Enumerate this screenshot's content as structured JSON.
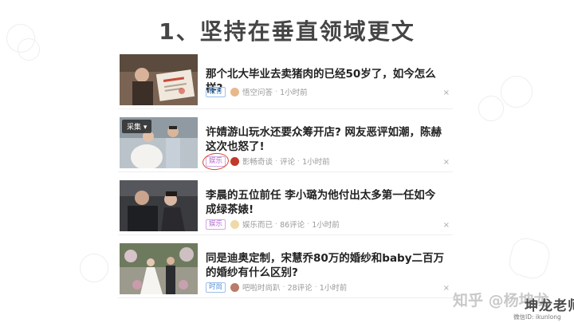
{
  "title": "1、坚持在垂直领域更文",
  "articles": [
    {
      "headline": "那个北大毕业去卖猪肉的已经50岁了，如今怎么样?",
      "tag": "教育",
      "author": "悟空问答",
      "time": "1小时前",
      "close": "×"
    },
    {
      "headline": "许婧游山玩水还要众筹开店? 网友恶评如潮，陈赫这次也怒了!",
      "thumb_overlay": "采集 ▾",
      "tag": "娱乐",
      "author": "影畅奇谈",
      "comments": "评论",
      "time": "1小时前",
      "close": "×"
    },
    {
      "headline": "李晨的五位前任 李小璐为他付出太多第一任如今成绿茶婊!",
      "tag": "娱乐",
      "author": "娱乐而已",
      "comments": "86评论",
      "time": "1小时前",
      "close": "×"
    },
    {
      "headline": "同是迪奥定制，宋慧乔80万的婚纱和baby二百万的婚纱有什么区别?",
      "tag": "时尚",
      "author": "吧啦时尚趴",
      "comments": "28评论",
      "time": "1小时前",
      "close": "×"
    }
  ],
  "watermark": "知乎 @杨坤龙",
  "brand": "坤龙老师",
  "wechat": "微信ID: ikunlong",
  "colors": {
    "tag_blue": "#4a8bd6",
    "tag_purple": "#b36ad0",
    "circle_mark": "#d94a2b"
  }
}
